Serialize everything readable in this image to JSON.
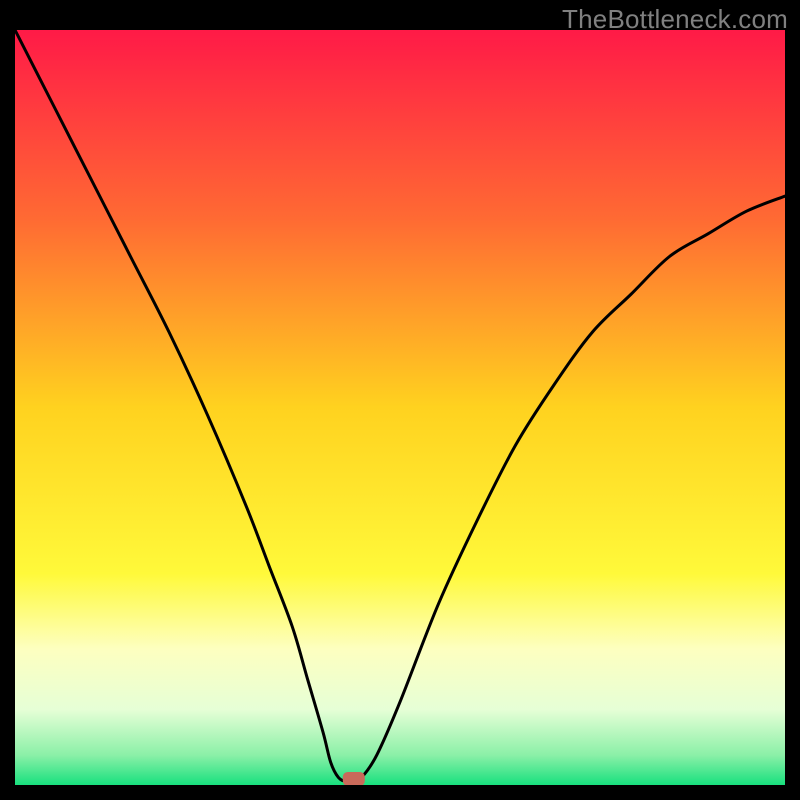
{
  "attribution": "TheBottleneck.com",
  "chart_data": {
    "type": "line",
    "title": "",
    "xlabel": "",
    "ylabel": "",
    "xlim": [
      0,
      100
    ],
    "ylim": [
      0,
      100
    ],
    "x": [
      0,
      5,
      10,
      15,
      20,
      25,
      30,
      33,
      36,
      38,
      40,
      41,
      42,
      43,
      44,
      45,
      47,
      50,
      55,
      60,
      65,
      70,
      75,
      80,
      85,
      90,
      95,
      100
    ],
    "values": [
      100,
      90,
      80,
      70,
      60,
      49,
      37,
      29,
      21,
      14,
      7,
      3,
      1,
      0.5,
      0.8,
      1,
      4,
      11,
      24,
      35,
      45,
      53,
      60,
      65,
      70,
      73,
      76,
      78
    ],
    "marker": {
      "x": 44,
      "y": 0.8,
      "color": "#c96a5a"
    },
    "background_gradient_stops": [
      {
        "offset": 0.0,
        "color": "#ff1a47"
      },
      {
        "offset": 0.25,
        "color": "#ff6a33"
      },
      {
        "offset": 0.5,
        "color": "#ffd21f"
      },
      {
        "offset": 0.72,
        "color": "#fff93a"
      },
      {
        "offset": 0.82,
        "color": "#fdffc0"
      },
      {
        "offset": 0.9,
        "color": "#e6ffd6"
      },
      {
        "offset": 0.96,
        "color": "#8cf0a8"
      },
      {
        "offset": 1.0,
        "color": "#18e07e"
      }
    ]
  }
}
